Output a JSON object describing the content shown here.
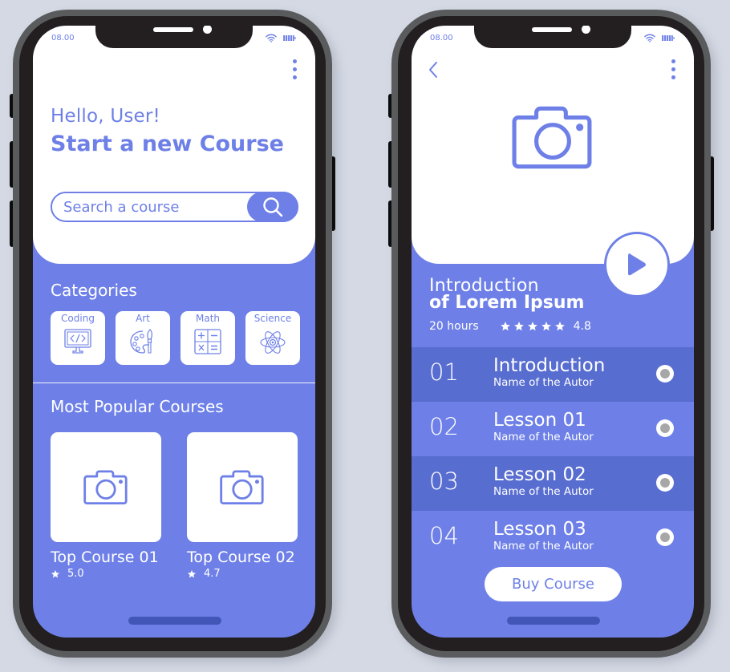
{
  "colors": {
    "accent": "#6e80e7",
    "accent_dark_row": "#586dd0",
    "home_indicator": "#4256b8",
    "background": "#d4d9e4",
    "radio_inner": "#a7a7a7"
  },
  "home_screen": {
    "status_bar": {
      "time": "08.00",
      "icons": [
        "wifi-icon",
        "battery-icon"
      ]
    },
    "menu_icon": "kebab-menu-icon",
    "greeting": "Hello, User!",
    "headline": "Start a new Course",
    "search": {
      "placeholder": "Search a course",
      "value": "",
      "button_icon": "search-icon"
    },
    "categories_title": "Categories",
    "categories": [
      {
        "label": "Coding",
        "icon": "code-monitor-icon"
      },
      {
        "label": "Art",
        "icon": "palette-brush-icon"
      },
      {
        "label": "Math",
        "icon": "calculator-operators-icon"
      },
      {
        "label": "Science",
        "icon": "atom-icon"
      }
    ],
    "popular_title": "Most Popular Courses",
    "popular_courses": [
      {
        "title": "Top Course 01",
        "rating": "5.0",
        "thumb_icon": "camera-icon"
      },
      {
        "title": "Top Course 02",
        "rating": "4.7",
        "thumb_icon": "camera-icon"
      }
    ]
  },
  "detail_screen": {
    "status_bar": {
      "time": "08.00",
      "icons": [
        "wifi-icon",
        "battery-icon"
      ]
    },
    "back_icon": "chevron-left-icon",
    "menu_icon": "kebab-menu-icon",
    "hero_icon": "camera-icon",
    "play_icon": "play-icon",
    "title_line1": "Introduction",
    "title_line2": "of Lorem Ipsum",
    "duration": "20 hours",
    "stars": 5,
    "rating": "4.8",
    "lessons": [
      {
        "number": "01",
        "title": "Introduction",
        "author": "Name of the Autor"
      },
      {
        "number": "02",
        "title": "Lesson 01",
        "author": "Name of the Autor"
      },
      {
        "number": "03",
        "title": "Lesson 02",
        "author": "Name of the Autor"
      },
      {
        "number": "04",
        "title": "Lesson 03",
        "author": "Name of the Autor"
      }
    ],
    "buy_label": "Buy Course"
  }
}
